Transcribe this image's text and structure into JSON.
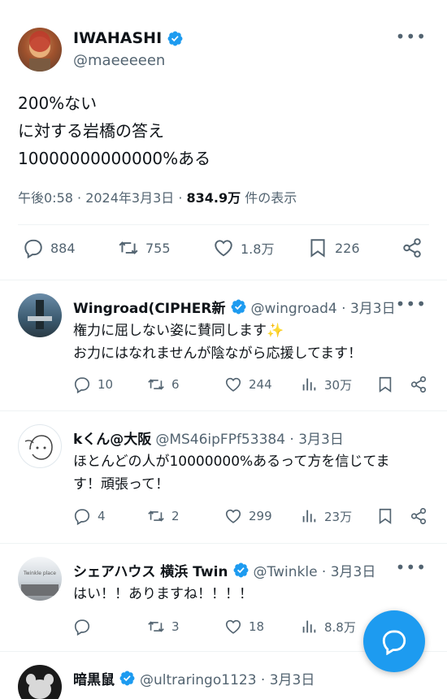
{
  "main_tweet": {
    "name": "IWAHASHI",
    "handle": "@maeeeeen",
    "text_lines": [
      "200%ない",
      "に対する岩橋の答え",
      "10000000000000%ある"
    ],
    "time": "午後0:58 · 2024年3月3日 · ",
    "views": "834.9万",
    "views_suffix": " 件の表示",
    "replies": "884",
    "retweets": "755",
    "likes": "1.8万",
    "bookmarks": "226"
  },
  "replies": [
    {
      "name": "Wingroad(CIPHER新",
      "handle": "@wingroad4 · 3月3日",
      "line1": "権力に屈しない姿に賛同します✨",
      "line2": "お力にはなれませんが陰ながら応援してます！",
      "replies": "10",
      "retweets": "6",
      "likes": "244",
      "views": "30万"
    },
    {
      "name": "kくん@大阪",
      "handle": "@MS46ipFPf53384 · 3月3日",
      "line1": "ほとんどの人が10000000%あるって方を信じてま",
      "line2": "す！頑張って！",
      "replies": "4",
      "retweets": "2",
      "likes": "299",
      "views": "23万"
    },
    {
      "name": "シェアハウス 横浜 Twin",
      "handle": "@Twinkle · 3月3日",
      "line1": "はい！！ありますね！！！！",
      "avatar_text": "Twinkle place",
      "replies": "",
      "retweets": "3",
      "likes": "18",
      "views": "8.8万"
    },
    {
      "name": "暗黒鼠",
      "handle": "@ultraringo1123 · 3月3日"
    }
  ],
  "colors": {
    "accent": "#1d9bf0",
    "muted": "#536471",
    "text": "#0f1419"
  },
  "icons": [
    "verified-badge-icon",
    "more-icon",
    "reply-icon",
    "retweet-icon",
    "like-icon",
    "bookmark-icon",
    "share-icon",
    "views-icon",
    "compose-icon"
  ]
}
